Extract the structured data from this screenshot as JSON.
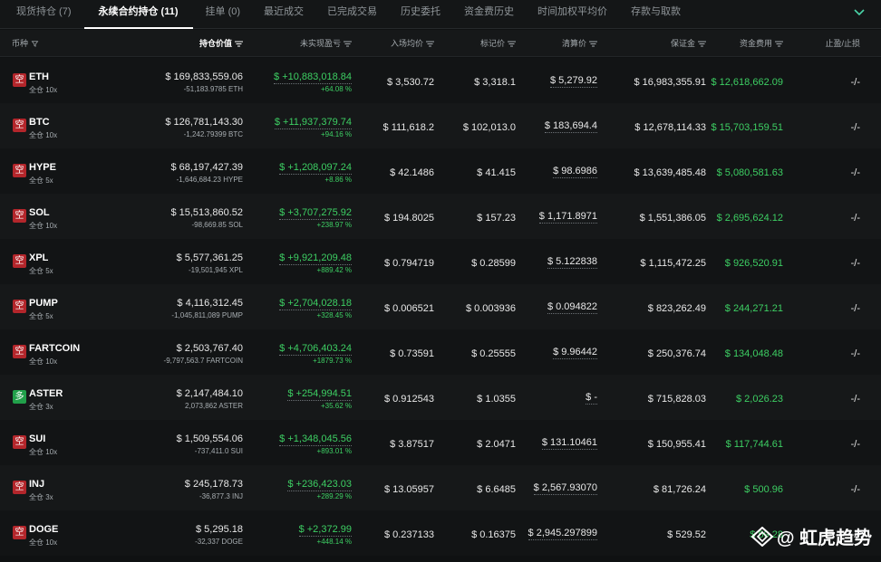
{
  "tabs": [
    {
      "label": "现货持仓 (7)"
    },
    {
      "label": "永续合约持仓 (11)"
    },
    {
      "label": "挂单 (0)"
    },
    {
      "label": "最近成交"
    },
    {
      "label": "已完成交易"
    },
    {
      "label": "历史委托"
    },
    {
      "label": "资金费历史"
    },
    {
      "label": "时间加权平均价"
    },
    {
      "label": "存款与取款"
    }
  ],
  "active_tab": 1,
  "columns": {
    "coin": "币种",
    "position_value": "持仓价值",
    "unrealized_pnl": "未实现盈亏",
    "entry_price": "入场均价",
    "mark_price": "标记价",
    "liq_price": "清算价",
    "margin": "保证金",
    "funding": "资金费用",
    "tp_sl": "止盈/止损"
  },
  "rows": [
    {
      "side": "空",
      "coin": "ETH",
      "mode": "全仓 10x",
      "value": "$ 169,833,559.06",
      "size": "-51,183.9785 ETH",
      "pnl": "$ +10,883,018.84",
      "pnl_pct": "+64.08 %",
      "entry": "$ 3,530.72",
      "mark": "$ 3,318.1",
      "liq": "$ 5,279.92",
      "margin": "$ 16,983,355.91",
      "funding": "$ 12,618,662.09",
      "tpsl": "-/-"
    },
    {
      "side": "空",
      "coin": "BTC",
      "mode": "全仓 10x",
      "value": "$ 126,781,143.30",
      "size": "-1,242.79399 BTC",
      "pnl": "$ +11,937,379.74",
      "pnl_pct": "+94.16 %",
      "entry": "$ 111,618.2",
      "mark": "$ 102,013.0",
      "liq": "$ 183,694.4",
      "margin": "$ 12,678,114.33",
      "funding": "$ 15,703,159.51",
      "tpsl": "-/-"
    },
    {
      "side": "空",
      "coin": "HYPE",
      "mode": "全仓 5x",
      "value": "$ 68,197,427.39",
      "size": "-1,646,684.23 HYPE",
      "pnl": "$ +1,208,097.24",
      "pnl_pct": "+8.86 %",
      "entry": "$ 42.1486",
      "mark": "$ 41.415",
      "liq": "$ 98.6986",
      "margin": "$ 13,639,485.48",
      "funding": "$ 5,080,581.63",
      "tpsl": "-/-"
    },
    {
      "side": "空",
      "coin": "SOL",
      "mode": "全仓 10x",
      "value": "$ 15,513,860.52",
      "size": "-98,669.85 SOL",
      "pnl": "$ +3,707,275.92",
      "pnl_pct": "+238.97 %",
      "entry": "$ 194.8025",
      "mark": "$ 157.23",
      "liq": "$ 1,171.8971",
      "margin": "$ 1,551,386.05",
      "funding": "$ 2,695,624.12",
      "tpsl": "-/-"
    },
    {
      "side": "空",
      "coin": "XPL",
      "mode": "全仓 5x",
      "value": "$ 5,577,361.25",
      "size": "-19,501,945 XPL",
      "pnl": "$ +9,921,209.48",
      "pnl_pct": "+889.42 %",
      "entry": "$ 0.794719",
      "mark": "$ 0.28599",
      "liq": "$ 5.122838",
      "margin": "$ 1,115,472.25",
      "funding": "$ 926,520.91",
      "tpsl": "-/-"
    },
    {
      "side": "空",
      "coin": "PUMP",
      "mode": "全仓 5x",
      "value": "$ 4,116,312.45",
      "size": "-1,045,811,089 PUMP",
      "pnl": "$ +2,704,028.18",
      "pnl_pct": "+328.45 %",
      "entry": "$ 0.006521",
      "mark": "$ 0.003936",
      "liq": "$ 0.094822",
      "margin": "$ 823,262.49",
      "funding": "$ 244,271.21",
      "tpsl": "-/-"
    },
    {
      "side": "空",
      "coin": "FARTCOIN",
      "mode": "全仓 10x",
      "value": "$ 2,503,767.40",
      "size": "-9,797,563.7 FARTCOIN",
      "pnl": "$ +4,706,403.24",
      "pnl_pct": "+1879.73 %",
      "entry": "$ 0.73591",
      "mark": "$ 0.25555",
      "liq": "$ 9.96442",
      "margin": "$ 250,376.74",
      "funding": "$ 134,048.48",
      "tpsl": "-/-"
    },
    {
      "side": "多",
      "coin": "ASTER",
      "mode": "全仓 3x",
      "value": "$ 2,147,484.10",
      "size": "2,073,862 ASTER",
      "pnl": "$ +254,994.51",
      "pnl_pct": "+35.62 %",
      "entry": "$ 0.912543",
      "mark": "$ 1.0355",
      "liq": "$ -",
      "margin": "$ 715,828.03",
      "funding": "$ 2,026.23",
      "tpsl": "-/-"
    },
    {
      "side": "空",
      "coin": "SUI",
      "mode": "全仓 10x",
      "value": "$ 1,509,554.06",
      "size": "-737,411.0 SUI",
      "pnl": "$ +1,348,045.56",
      "pnl_pct": "+893.01 %",
      "entry": "$ 3.87517",
      "mark": "$ 2.0471",
      "liq": "$ 131.10461",
      "margin": "$ 150,955.41",
      "funding": "$ 117,744.61",
      "tpsl": "-/-"
    },
    {
      "side": "空",
      "coin": "INJ",
      "mode": "全仓 3x",
      "value": "$ 245,178.73",
      "size": "-36,877.3 INJ",
      "pnl": "$ +236,423.03",
      "pnl_pct": "+289.29 %",
      "entry": "$ 13.05957",
      "mark": "$ 6.6485",
      "liq": "$ 2,567.93070",
      "margin": "$ 81,726.24",
      "funding": "$ 500.96",
      "tpsl": "-/-"
    },
    {
      "side": "空",
      "coin": "DOGE",
      "mode": "全仓 10x",
      "value": "$ 5,295.18",
      "size": "-32,337 DOGE",
      "pnl": "$ +2,372.99",
      "pnl_pct": "+448.14 %",
      "entry": "$ 0.237133",
      "mark": "$ 0.16375",
      "liq": "$ 2,945.297899",
      "margin": "$ 529.52",
      "funding": "$ 59.28",
      "tpsl": "-/-"
    }
  ],
  "watermark": "@ 虹虎趋势",
  "colors": {
    "green": "#3dcf63",
    "short": "#b3262b",
    "long": "#21a04a",
    "accent": "#4ad4a8"
  }
}
